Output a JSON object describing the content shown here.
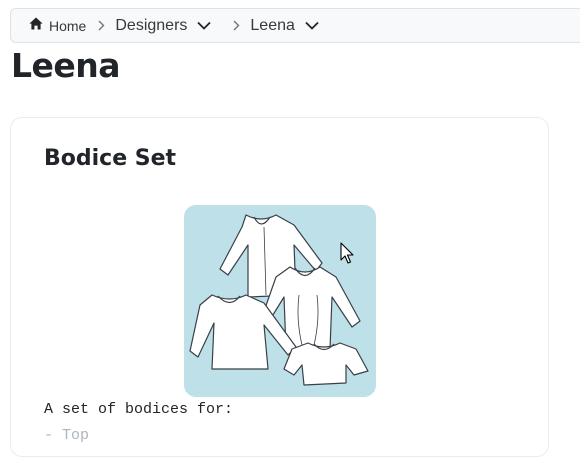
{
  "breadcrumb": {
    "home_label": "Home",
    "designers_label": "Designers",
    "current_label": "Leena"
  },
  "page": {
    "title": "Leena"
  },
  "card": {
    "title": "Bodice Set",
    "image_alt": "Technical flat drawings of three long-sleeve bodices and one short-sleeve bodice",
    "description": "A set of bodices for:",
    "list_items": [
      "- Top"
    ]
  },
  "icons": {
    "home": "home-icon",
    "chevron_right": "chevron-right-icon",
    "chevron_down": "chevron-down-icon",
    "cursor": "mouse-pointer-icon"
  },
  "colors": {
    "breadcrumb_bg": "#f8f9fa",
    "image_bg": "#bde0e9",
    "text": "#212529",
    "muted": "#adb5bd"
  }
}
